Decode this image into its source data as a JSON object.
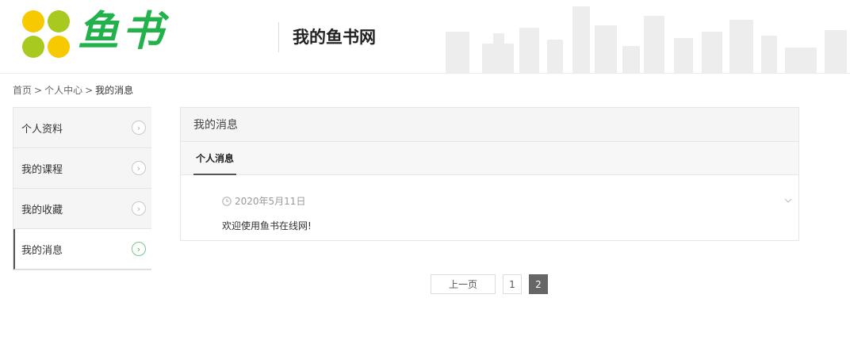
{
  "header": {
    "logo_text": "鱼书",
    "site_title": "我的鱼书网"
  },
  "breadcrumb": {
    "home": "首页",
    "center": "个人中心",
    "current": "我的消息",
    "separator": ">"
  },
  "sidebar": {
    "items": [
      {
        "label": "个人资料",
        "active": false
      },
      {
        "label": "我的课程",
        "active": false
      },
      {
        "label": "我的收藏",
        "active": false
      },
      {
        "label": "我的消息",
        "active": true
      }
    ]
  },
  "panel": {
    "title": "我的消息",
    "tab": "个人消息",
    "messages": [
      {
        "date": "2020年5月11日",
        "body": "欢迎使用鱼书在线网!"
      }
    ]
  },
  "pagination": {
    "prev": "上一页",
    "pages": [
      "1",
      "2"
    ],
    "current": "2"
  },
  "colors": {
    "brand_green": "#22b24c",
    "logo_yellow": "#f6c900",
    "logo_lime": "#a8c920",
    "active_page": "#666666"
  }
}
